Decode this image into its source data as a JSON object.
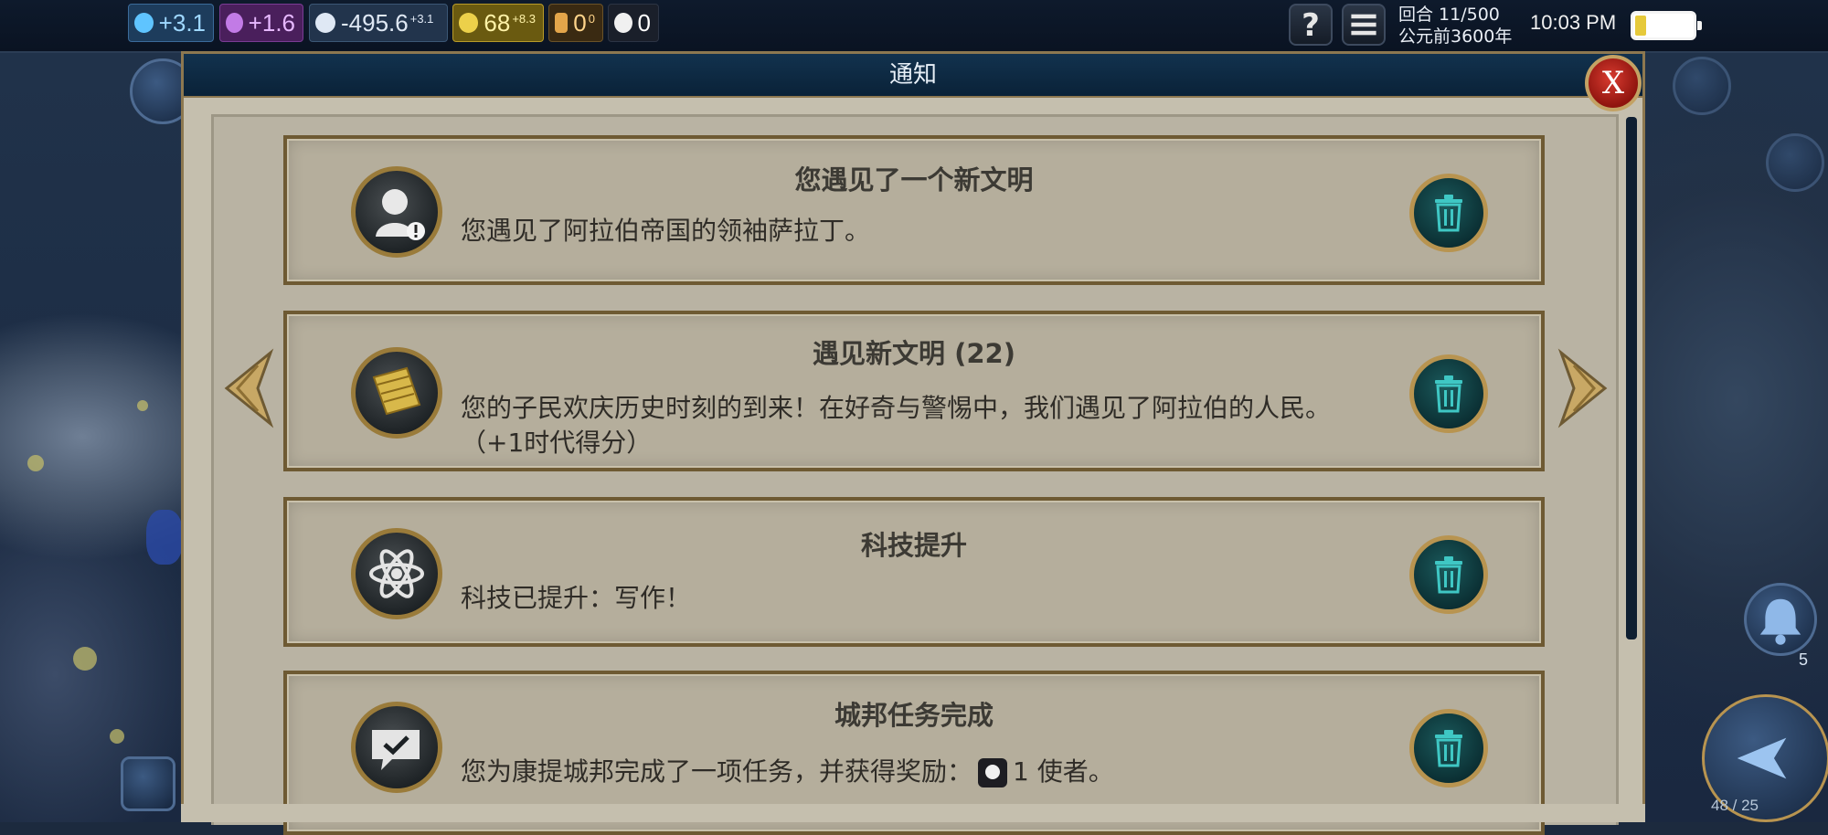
{
  "topbar": {
    "science": "+3.1",
    "culture": "+1.6",
    "faith": "-495.6",
    "faith_rate": "+3.1",
    "gold": "68",
    "gold_rate": "+8.3",
    "tourism": "0",
    "tourism_rate": "0",
    "envoys": "0",
    "turn": "回合 11/500",
    "era_year": "公元前3600年",
    "time": "10:03 PM",
    "battery_level_percent": 20,
    "help_label": "?",
    "menu_label": "≡"
  },
  "dialog": {
    "title": "通知",
    "close_label": "X"
  },
  "notifications": [
    {
      "title": "您遇见了一个新文明",
      "text": "您遇见了阿拉伯帝国的领袖萨拉丁。",
      "icon": "leader-met-icon"
    },
    {
      "title": "遇见新文明 (22)",
      "text": "您的子民欢庆历史时刻的到来！在好奇与警惕中，我们遇见了阿拉伯的人民。（+1时代得分）",
      "icon": "historic-moment-scroll-icon"
    },
    {
      "title": "科技提升",
      "text": "科技已提升：写作！",
      "icon": "technology-atom-icon"
    },
    {
      "title": "城邦任务完成",
      "text_before": "您为康提城邦完成了一项任务，并获得奖励：",
      "text_after": "1 使者。",
      "icon": "city-state-quest-icon"
    }
  ],
  "side": {
    "notification_count": "5",
    "unit_counter": "48 / 25"
  },
  "colors": {
    "dialog_header": "#0a2238",
    "parchment": "#b5ae9c",
    "gold_trim": "#9a7b3a",
    "trash_teal": "#1b5a5c",
    "close_red": "#c8281e"
  }
}
